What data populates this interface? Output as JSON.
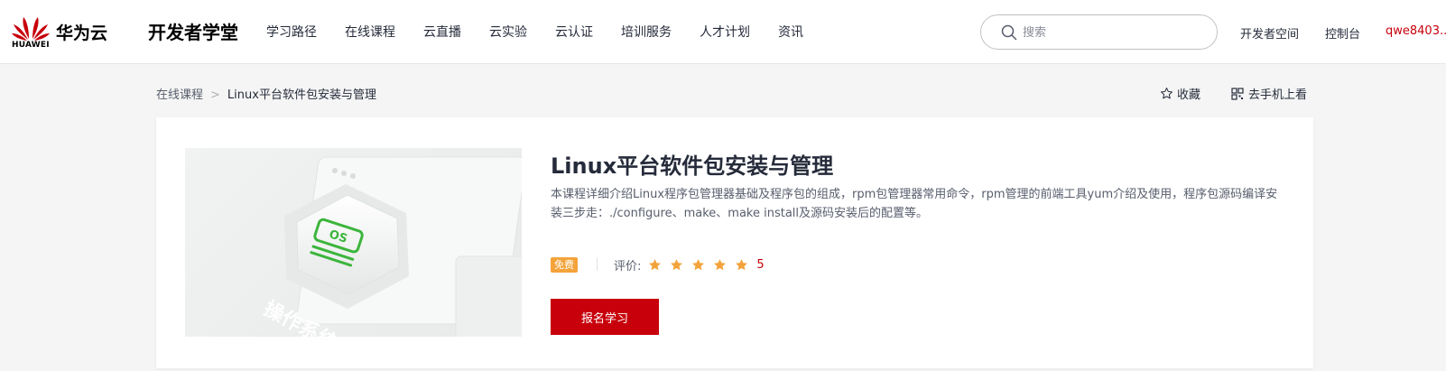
{
  "header": {
    "logo_text": "HUAWEI",
    "brand": "华为云",
    "site_title": "开发者学堂",
    "nav": [
      "学习路径",
      "在线课程",
      "云直播",
      "云实验",
      "云认证",
      "培训服务",
      "人才计划",
      "资讯"
    ],
    "search_placeholder": "搜索",
    "dev_space": "开发者空间",
    "console": "控制台",
    "user": "qwe8403..."
  },
  "breadcrumb": {
    "parent": "在线课程",
    "separator": ">",
    "current": "Linux平台软件包安装与管理"
  },
  "actions": {
    "favorite": "收藏",
    "mobile": "去手机上看"
  },
  "course": {
    "cover_text": "操作系统",
    "cover_badge": "OS",
    "title": "Linux平台软件包安装与管理",
    "description": "本课程详细介绍Linux程序包管理器基础及程序包的组成，rpm包管理器常用命令，rpm管理的前端工具yum介绍及使用，程序包源码编译安装三步走：./configure、make、make install及源码安装后的配置等。",
    "price_badge": "免费",
    "rating_label": "评价:",
    "rating": 5,
    "rating_text": "5",
    "enroll_button": "报名学习"
  },
  "colors": {
    "brand_red": "#c7000b",
    "star": "#f3a33a",
    "badge": "#f3a33a",
    "cover_green": "#3cb53c"
  }
}
